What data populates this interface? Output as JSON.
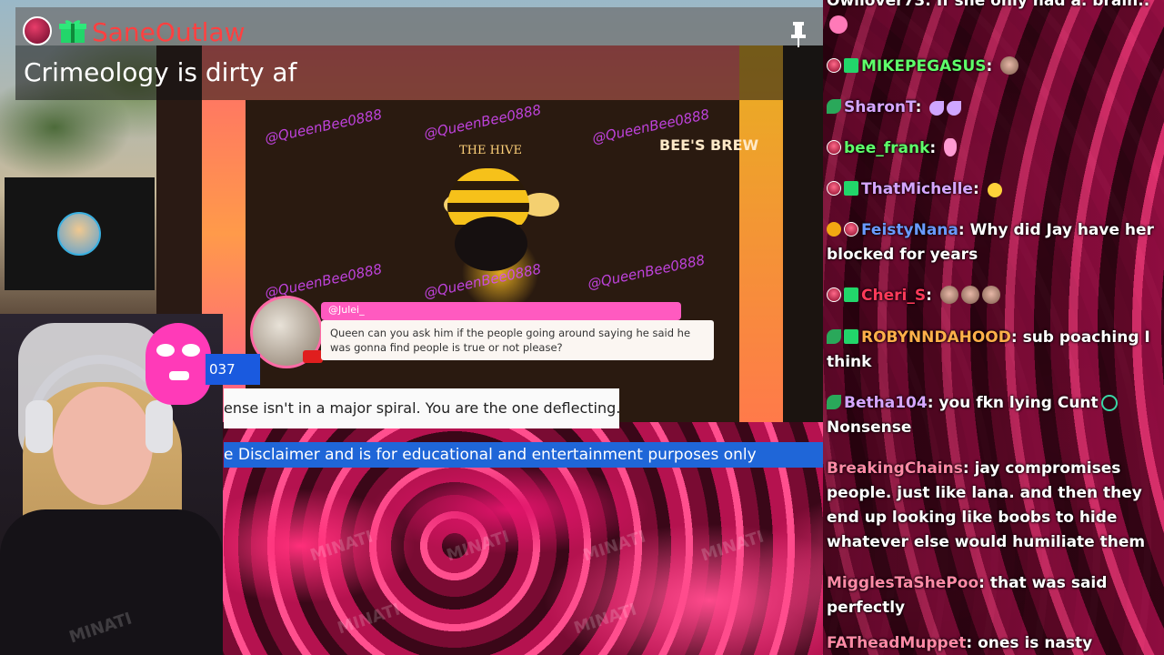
{
  "popup": {
    "username": "SaneOutlaw",
    "message": "Crimeology is dirty af",
    "username_color": "#ff4040"
  },
  "stream": {
    "watermark": "@QueenBee0888",
    "sign": "BEE'S BREW",
    "bar_name": "THE HIVE",
    "question_user": "@Julei_",
    "question_text": "Queen can you ask him if the people going around saying he said he was gonna find people is true or not please?",
    "id_tag": "037",
    "caption_white": "ense isn't in a major spiral. You are the one deflecting.",
    "caption_blue": "e Disclaimer and is for educational and entertainment purposes only",
    "overlay_watermark": "MINATI"
  },
  "chat": {
    "messages": [
      {
        "user": "Owllover73",
        "color": "#ffffff",
        "text": "If she only had a. brain..",
        "badges": [],
        "emotes": [
          "brain"
        ]
      },
      {
        "user": "MIKEPEGASUS",
        "color": "#5fff6a",
        "text": "",
        "badges": [
          "crown",
          "gift"
        ],
        "emotes": [
          "face"
        ]
      },
      {
        "user": "SharonT",
        "color": "#d6a6ff",
        "text": "",
        "badges": [
          "leaf"
        ],
        "emotes": [
          "moon",
          "moon"
        ]
      },
      {
        "user": "bee_frank",
        "color": "#5fff6a",
        "text": "",
        "badges": [
          "crown"
        ],
        "emotes": [
          "bunny"
        ]
      },
      {
        "user": "ThatMichelle",
        "color": "#d6a6ff",
        "text": "",
        "badges": [
          "crown",
          "gift"
        ],
        "emotes": [
          "smile"
        ]
      },
      {
        "user": "FeistyNana",
        "color": "#6a9aff",
        "text": "Why did Jay have her blocked for years",
        "badges": [
          "coin",
          "crown"
        ],
        "emotes": []
      },
      {
        "user": "Cheri_S",
        "color": "#ff3a5a",
        "text": "",
        "badges": [
          "crown",
          "gift"
        ],
        "emotes": [
          "face",
          "face",
          "face"
        ]
      },
      {
        "user": "ROBYNNDAHOOD",
        "color": "#ffb04a",
        "text": "sub poaching I think",
        "badges": [
          "leaf",
          "gift"
        ],
        "emotes": []
      },
      {
        "user": "Betha104",
        "color": "#d6a6ff",
        "text": "you fkn lying Cunt",
        "text2": "Nonsense",
        "badges": [
          "leaf"
        ],
        "emotes": [
          "swirl"
        ]
      },
      {
        "user": "BreakingChains",
        "color": "#ff8aa6",
        "text": "jay compromises people. just like lana. and then they end up looking like boobs to hide whatever else would humiliate them",
        "badges": [],
        "emotes": []
      },
      {
        "user": "MigglesTaShePoo",
        "color": "#ff8aa6",
        "text": "that was said perfectly",
        "badges": [],
        "emotes": []
      },
      {
        "user": "FATheadMuppet",
        "color": "#ff8aa6",
        "text": "ones is nasty",
        "badges": [],
        "emotes": []
      }
    ]
  }
}
